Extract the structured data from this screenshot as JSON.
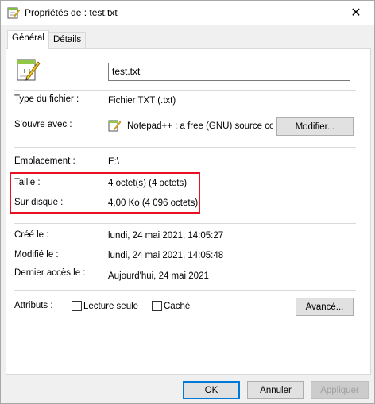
{
  "window": {
    "title": "Propriétés de : test.txt",
    "close_glyph": "✕"
  },
  "tabs": [
    {
      "label": "Général",
      "active": true
    },
    {
      "label": "Détails",
      "active": false
    }
  ],
  "file": {
    "name": "test.txt",
    "type_label": "Type du fichier :",
    "type_value": "Fichier TXT (.txt)",
    "opens_with_label": "S'ouvre avec :",
    "opens_with_value": "Notepad++ : a free (GNU) source coc",
    "modify_button": "Modifier..."
  },
  "location": {
    "label": "Emplacement :",
    "value": "E:\\"
  },
  "size": {
    "label": "Taille :",
    "value": "4 octet(s) (4 octets)",
    "disk_label": "Sur disque :",
    "disk_value": "4,00 Ko (4 096 octets)"
  },
  "dates": {
    "created_label": "Créé le :",
    "created_value": "lundi, 24 mai 2021, 14:05:27",
    "modified_label": "Modifié le :",
    "modified_value": "lundi, 24 mai 2021, 14:05:48",
    "accessed_label": "Dernier accès le :",
    "accessed_value": "Aujourd'hui, 24 mai 2021"
  },
  "attributes": {
    "label": "Attributs :",
    "readonly_label": "Lecture seule",
    "readonly_checked": false,
    "hidden_label": "Caché",
    "hidden_checked": false,
    "advanced_button": "Avancé..."
  },
  "footer": {
    "ok": "OK",
    "cancel": "Annuler",
    "apply": "Appliquer"
  },
  "colors": {
    "highlight_box": "#e81123",
    "default_button_border": "#0078d7"
  },
  "icons": {
    "title": "notepad-plus-plus-icon",
    "file": "notepad-plus-plus-icon",
    "opens_with": "notepad-plus-plus-icon"
  }
}
